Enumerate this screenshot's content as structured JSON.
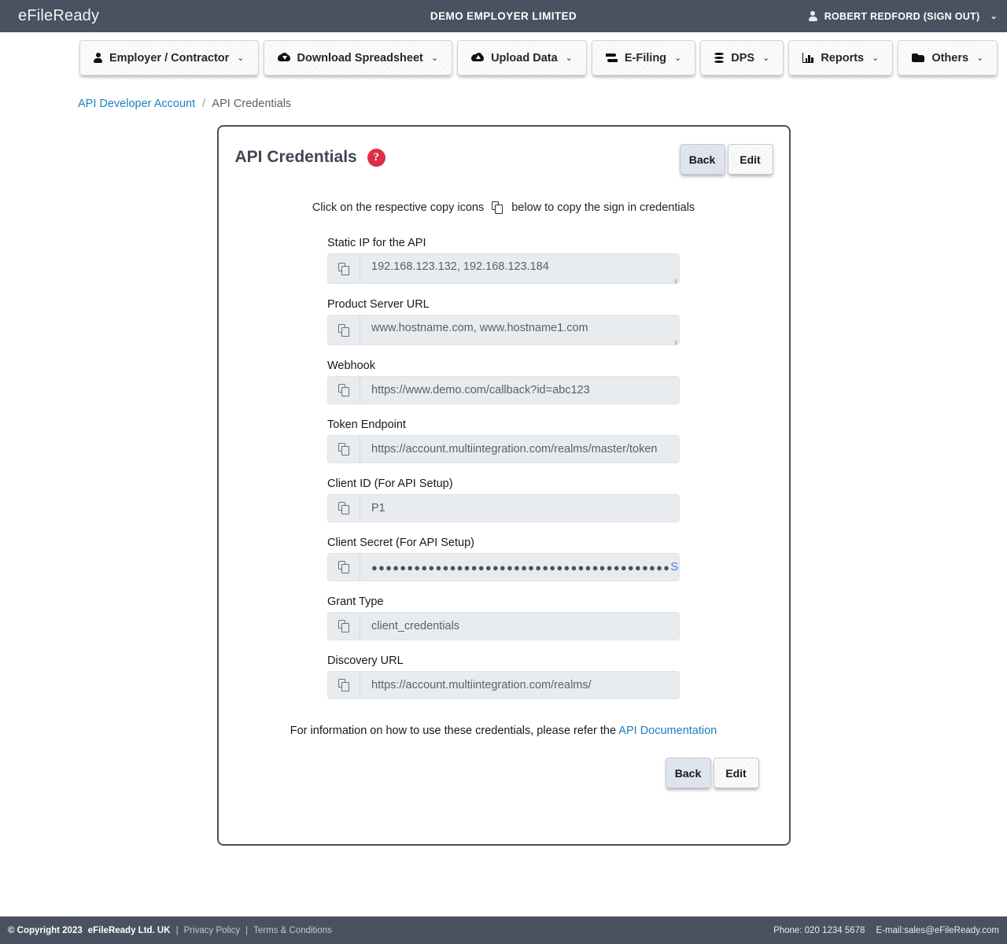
{
  "header": {
    "brand": "eFileReady",
    "company": "DEMO EMPLOYER LIMITED",
    "user": "ROBERT REDFORD (SIGN OUT)",
    "user_icon": "person-icon",
    "caret": "⌄"
  },
  "nav": {
    "items": [
      {
        "label": "Employer / Contractor",
        "icon": "person-icon",
        "caret": "⌄"
      },
      {
        "label": "Download Spreadsheet",
        "icon": "cloud-download-icon",
        "caret": "⌄"
      },
      {
        "label": "Upload Data",
        "icon": "cloud-upload-icon",
        "caret": "⌄"
      },
      {
        "label": "E-Filing",
        "icon": "transfer-icon",
        "caret": "⌄"
      },
      {
        "label": "DPS",
        "icon": "database-icon",
        "caret": "⌄"
      },
      {
        "label": "Reports",
        "icon": "bar-chart-icon",
        "caret": "⌄"
      },
      {
        "label": "Others",
        "icon": "folder-icon",
        "caret": "⌄"
      }
    ]
  },
  "breadcrumb": {
    "root": "API Developer Account",
    "separator": "/",
    "current": "API Credentials"
  },
  "panel": {
    "title": "API Credentials",
    "help_icon": "question-mark-icon",
    "help_glyph": "?",
    "back_label": "Back",
    "edit_label": "Edit",
    "hint_before": "Click on the respective copy icons",
    "hint_after": "below to copy the sign in credentials",
    "hint_icon": "copy-icon",
    "footnote_text": "For information on how to use these credentials, please refer the",
    "footnote_link": "API Documentation"
  },
  "fields": [
    {
      "label": "Static IP for the API",
      "value": "192.168.123.132, 192.168.123.184",
      "type": "textarea",
      "copy_icon": "copy-icon"
    },
    {
      "label": "Product Server URL",
      "value": "www.hostname.com, www.hostname1.com",
      "type": "textarea",
      "copy_icon": "copy-icon"
    },
    {
      "label": "Webhook",
      "value": "https://www.demo.com/callback?id=abc123",
      "type": "text",
      "copy_icon": "copy-icon"
    },
    {
      "label": "Token Endpoint",
      "value": "https://account.multiintegration.com/realms/master/token",
      "type": "text",
      "copy_icon": "copy-icon"
    },
    {
      "label": "Client ID (For API Setup)",
      "value": "P1",
      "type": "text",
      "copy_icon": "copy-icon"
    },
    {
      "label": "Client Secret (For API Setup)",
      "value": "●●●●●●●●●●●●●●●●●●●●●●●●●●●●●●●●●●●●●●●●●●",
      "type": "password",
      "show_label": "Show",
      "copy_icon": "copy-icon"
    },
    {
      "label": "Grant Type",
      "value": "client_credentials",
      "type": "text",
      "copy_icon": "copy-icon"
    },
    {
      "label": "Discovery URL",
      "value": "https://account.multiintegration.com/realms/",
      "type": "text",
      "copy_icon": "copy-icon"
    }
  ],
  "footer": {
    "copyright": "© Copyright 2023",
    "company": "eFileReady Ltd. UK",
    "sep": "|",
    "privacy": "Privacy Policy",
    "terms": "Terms & Conditions",
    "phone": "Phone: 020 1234 5678",
    "email": "E-mail:sales@eFileReady.com"
  },
  "colors": {
    "header_bg": "#4a5160",
    "link": "#1a7fc1",
    "help_red": "#dc2f47",
    "field_bg": "#e9ecef",
    "back_btn": "#dfe6f0"
  }
}
